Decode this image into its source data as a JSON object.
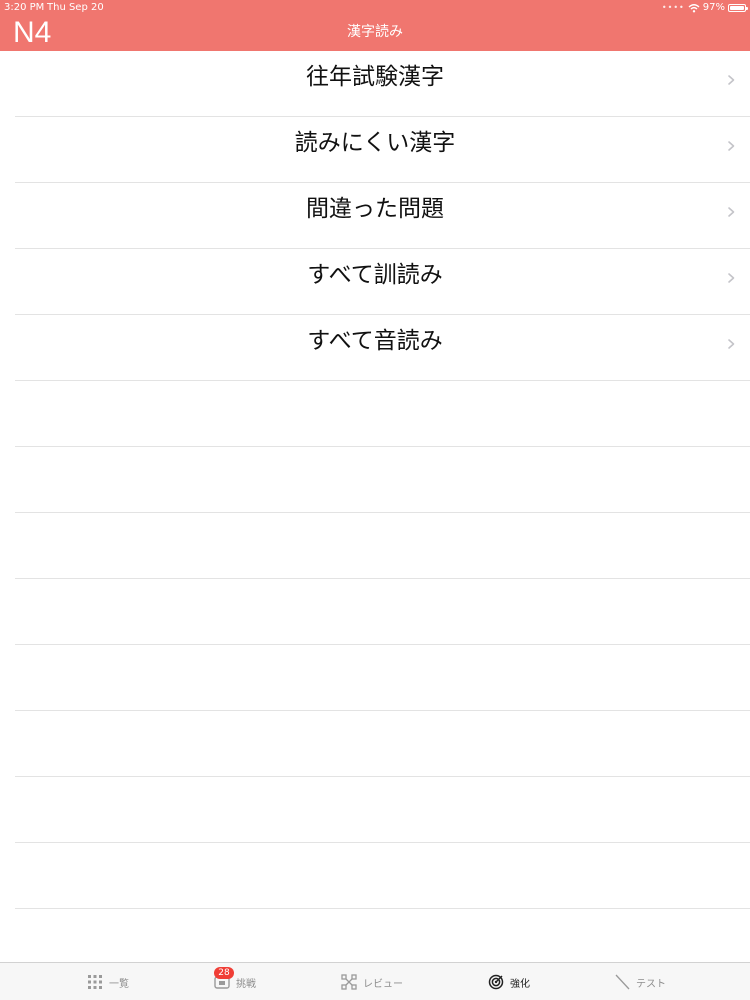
{
  "status_bar": {
    "time": "3:20 PM",
    "date": "Thu Sep 20",
    "battery": "97%",
    "battery_level": 0.97
  },
  "header": {
    "level": "N4",
    "title": "漢字読み",
    "background_color": "#f0766f"
  },
  "list": {
    "items": [
      {
        "label": "往年試験漢字"
      },
      {
        "label": "読みにくい漢字"
      },
      {
        "label": "間違った問題"
      },
      {
        "label": "すべて訓読み"
      },
      {
        "label": "すべて音読み"
      }
    ],
    "chevron_icon": "chevron-right-icon"
  },
  "tab_bar": {
    "tabs": [
      {
        "label": "一覧",
        "icon": "grid-icon"
      },
      {
        "label": "挑戦",
        "icon": "challenge-icon",
        "badge": "28"
      },
      {
        "label": "レビュー",
        "icon": "review-icon"
      },
      {
        "label": "強化",
        "icon": "target-icon",
        "active": true
      },
      {
        "label": "テスト",
        "icon": "pencil-icon"
      }
    ]
  }
}
